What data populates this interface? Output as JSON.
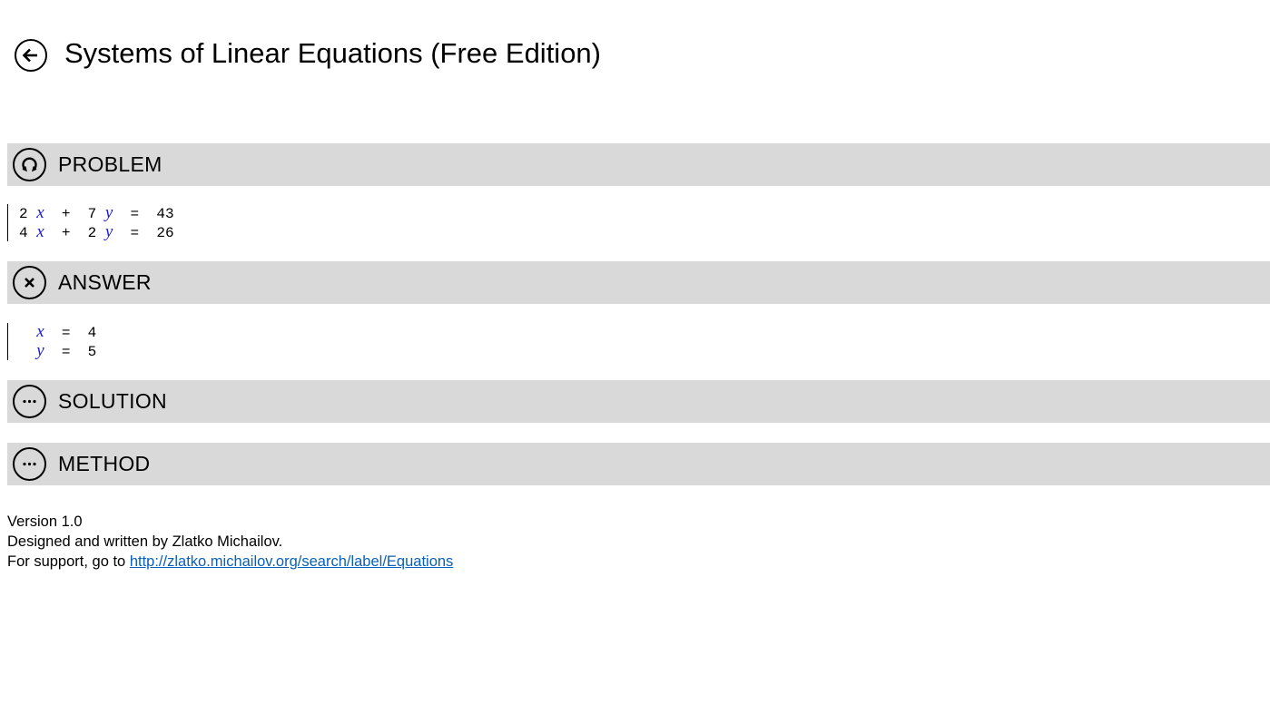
{
  "header": {
    "title": "Systems of Linear Equations (Free Edition)",
    "back_icon": "arrow-left-icon"
  },
  "sections": {
    "problem": {
      "label": "PROBLEM",
      "icon": "refresh-icon"
    },
    "answer": {
      "label": "ANSWER",
      "icon": "close-icon"
    },
    "solution": {
      "label": "SOLUTION",
      "icon": "more-icon"
    },
    "method": {
      "label": "METHOD",
      "icon": "more-icon"
    }
  },
  "problem": {
    "equations": [
      {
        "c1": "2",
        "v1": "x",
        "op": "+",
        "c2": "7",
        "v2": "y",
        "eq": "=",
        "rhs": "43"
      },
      {
        "c1": "4",
        "v1": "x",
        "op": "+",
        "c2": "2",
        "v2": "y",
        "eq": "=",
        "rhs": "26"
      }
    ]
  },
  "answer": {
    "rows": [
      {
        "var": "x",
        "eq": "=",
        "value": "4"
      },
      {
        "var": "y",
        "eq": "=",
        "value": "5"
      }
    ]
  },
  "footer": {
    "version": "Version 1.0",
    "credit": "Designed and written by Zlatko Michailov.",
    "support_prefix": "For support, go to ",
    "support_link": "http://zlatko.michailov.org/search/label/Equations"
  },
  "colors": {
    "section_bg": "#d9d9d9",
    "variable": "#1a1adc",
    "link": "#0a5fb8"
  }
}
